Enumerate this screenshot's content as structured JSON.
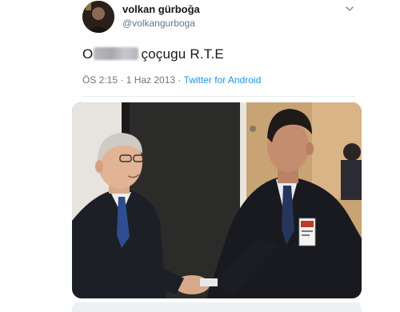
{
  "tweet": {
    "display_name": "volkan gürboğa",
    "handle": "@volkangurboga",
    "text_prefix": "O",
    "text_suffix": "çoçugu R.T.E",
    "time": "ÖS 2:15",
    "separator_1": " · ",
    "date": "1 Haz 2013",
    "separator_2": " · ",
    "source": "Twitter for Android"
  },
  "icons": {
    "avatar": "profile-avatar",
    "menu": "chevron-down-icon"
  },
  "colors": {
    "link": "#1b95e0",
    "secondary_text": "#657786",
    "primary_text": "#14171a"
  }
}
